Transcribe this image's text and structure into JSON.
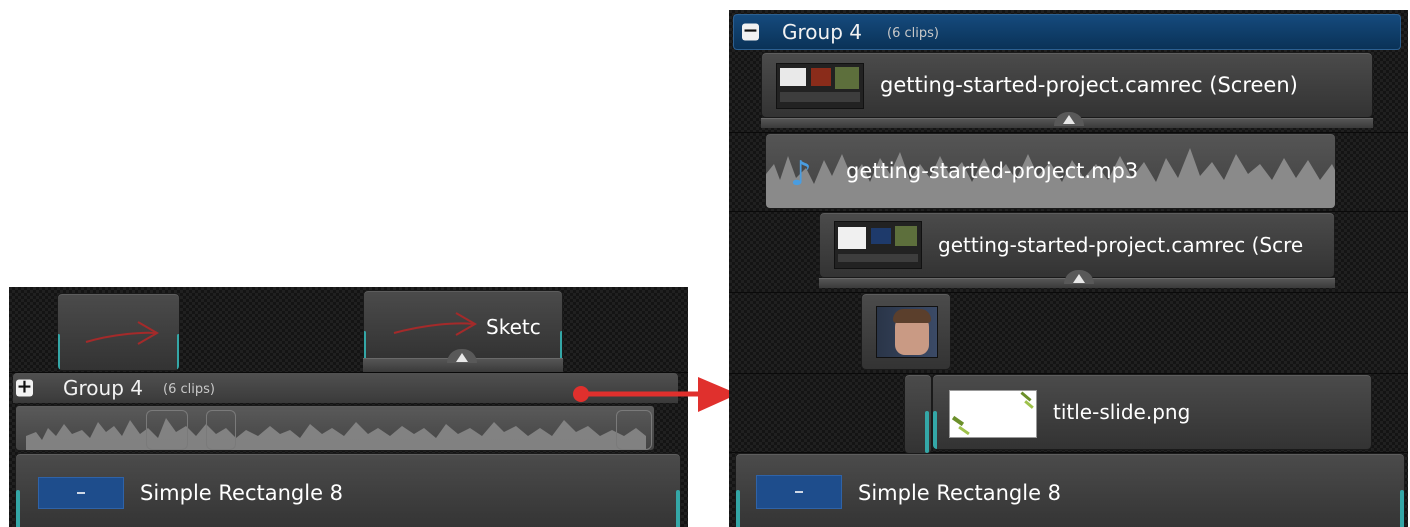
{
  "before": {
    "sketch_clip_label": "Sketc",
    "group": {
      "expand_glyph": "+",
      "title": "Group 4",
      "clip_count": "(6 clips)"
    },
    "rectangle_clip_label": "Simple Rectangle 8"
  },
  "after": {
    "group": {
      "collapse_glyph": "−",
      "title": "Group 4",
      "clip_count": "(6 clips)"
    },
    "clips": {
      "screen_recording_1": "getting-started-project.camrec (Screen)",
      "audio": "getting-started-project.mp3",
      "screen_recording_2": "getting-started-project.camrec (Scre",
      "image": "title-slide.png",
      "rectangle": "Simple Rectangle 8"
    }
  },
  "colors": {
    "accent_teal": "#34a7a7",
    "group_bar_blue": "#0d3a66",
    "arrow_red": "#e0302d",
    "rectangle_blue": "#1e4d8c"
  },
  "icons": [
    "plus-icon",
    "minus-icon",
    "music-note-icon",
    "collapse-triangle-icon",
    "sketch-arrow-icon"
  ]
}
